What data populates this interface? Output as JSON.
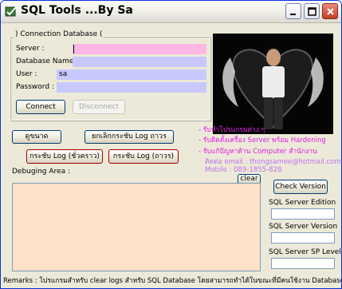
{
  "window": {
    "title": "SQL Tools ...By Sa"
  },
  "connection": {
    "group_caption": ") Connection Database (",
    "server_label": "Server :",
    "server_value": "",
    "database_label": "Database Name :",
    "database_value": "",
    "user_label": "User :",
    "user_value": "sa",
    "password_label": "Password :",
    "password_value": "",
    "connect_button": "Connect",
    "disconnect_button": "Disconnect"
  },
  "actions": {
    "view_button": "ดูขนาด",
    "cancel_log_button": "ยกเลิกกระชับ Log ถาวร",
    "shrink_temp_button": "กระชับ Log (ชั่วคราว)",
    "shrink_perm_button": "กระชับ Log (ถาวร)"
  },
  "promo": {
    "line1": "- รับทำโปรแกรมต่าง ๆ",
    "line2": "- รับติดตั้งเครื่อง Server พร้อม Hardening",
    "line3": "- รับแก้ปัญหาด้าน Computer สำนักงาน",
    "email": "ติดต่อ email : thongsamee@hotmail.com",
    "mobile": "Mobile : 089-1855-828"
  },
  "debug": {
    "label": "Debuging Area :",
    "clear_button": "clear"
  },
  "side": {
    "check_version_button": "Check Version",
    "edition_label": "SQL Server Edition",
    "version_label": "SQL Server Version",
    "sp_label": "SQL Server SP Level"
  },
  "status": {
    "remarks": "Remarks : โปรแกรมสำหรับ clear logs สำหรับ SQL Database โดยสามารถทำได้ในขณะที่มีคนใช้งาน Database อยู่"
  },
  "colors": {
    "window_bg": "#ECE9D8",
    "server_field": "#FFB7E6",
    "field_bg": "#C8C8FF",
    "debug_bg": "#FFE0C8",
    "promo_text": "#E020E0"
  }
}
